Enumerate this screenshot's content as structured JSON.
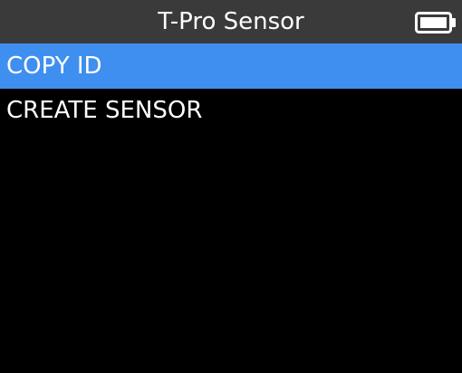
{
  "header": {
    "title": "T-Pro Sensor",
    "battery_icon": "battery-full-icon"
  },
  "menu": {
    "items": [
      {
        "label": "COPY ID",
        "selected": true
      },
      {
        "label": "CREATE SENSOR",
        "selected": false
      }
    ]
  },
  "colors": {
    "background": "#000000",
    "header_background": "#3a3a3a",
    "selection": "#3e8ff0",
    "text": "#ffffff"
  }
}
